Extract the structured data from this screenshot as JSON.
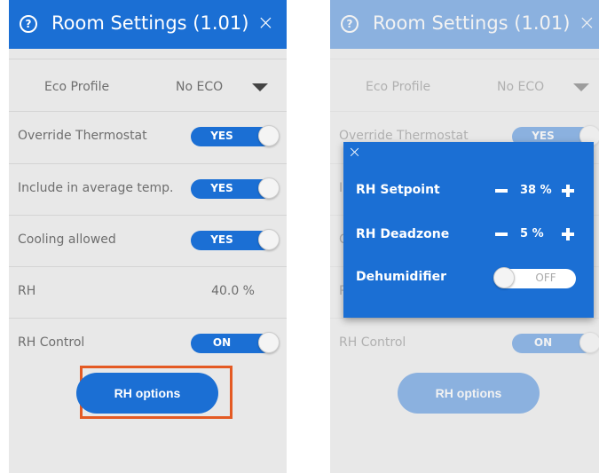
{
  "colors": {
    "accent": "#1b6fd4",
    "highlight": "#e45a23",
    "panel_bg": "#e8e8e8"
  },
  "header": {
    "title": "Room Settings (1.01)",
    "help_icon": "?",
    "close_icon": "×"
  },
  "eco": {
    "label": "Eco Profile",
    "value": "No ECO"
  },
  "rows": {
    "override": {
      "label": "Override Thermostat",
      "toggle": "YES"
    },
    "include": {
      "label": "Include in average temp.",
      "toggle": "YES"
    },
    "cooling": {
      "label": "Cooling allowed",
      "toggle": "YES"
    },
    "rh": {
      "label": "RH",
      "value": "40.0 %"
    },
    "rh_control": {
      "label": "RH Control",
      "toggle": "ON"
    }
  },
  "rh_button": "RH options",
  "modal": {
    "close_icon": "×",
    "setpoint": {
      "label": "RH Setpoint",
      "value": "38 %"
    },
    "deadzone": {
      "label": "RH Deadzone",
      "value": "5 %"
    },
    "dehumidifier": {
      "label": "Dehumidifier",
      "toggle": "OFF"
    }
  }
}
